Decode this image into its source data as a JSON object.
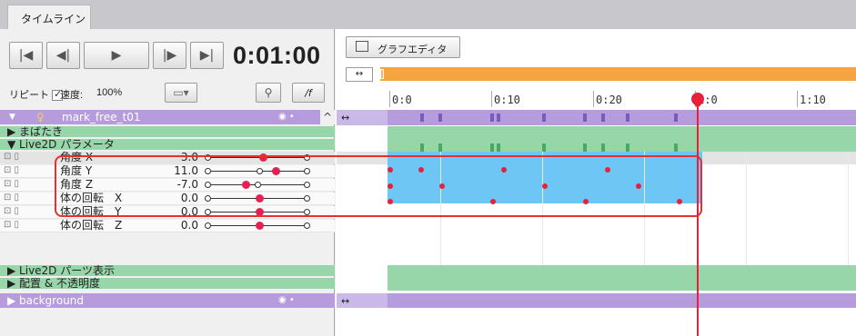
{
  "tab": {
    "label": "タイムライン"
  },
  "transport": {
    "timecode": "0:01:00",
    "buttons": [
      "jump-start",
      "prev-frame",
      "play",
      "next-frame",
      "jump-end"
    ]
  },
  "options": {
    "repeat_label": "リピート",
    "speed_label": "速度:",
    "speed_value": "100%",
    "f_button": "/f"
  },
  "rows": {
    "model_name": "mark_free_t01",
    "group_blink": "▶ まばたき",
    "group_params": "▼ Live2D パラメータ",
    "params": [
      {
        "name": "角度 X",
        "value": "3.0",
        "knob": 0.55,
        "ring": null
      },
      {
        "name": "角度 Y",
        "value": "11.0",
        "knob": 0.68,
        "ring": 0.52
      },
      {
        "name": "角度 Z",
        "value": "-7.0",
        "knob": 0.38,
        "ring": 0.5
      },
      {
        "name": "体の回転　X",
        "value": "0.0",
        "knob": 0.52,
        "ring": null
      },
      {
        "name": "体の回転　Y",
        "value": "0.0",
        "knob": 0.52,
        "ring": null
      },
      {
        "name": "体の回転　Z",
        "value": "0.0",
        "knob": 0.52,
        "ring": null
      }
    ],
    "group_parts": "▶ Live2D パーツ表示",
    "group_placement": "▶ 配置 & 不透明度",
    "background_name": "▶ background"
  },
  "graph_editor": {
    "label": "グラフエディタ"
  },
  "ruler": {
    "labels": [
      "0:0",
      "0:10",
      "0:20",
      "1:0",
      "1:10"
    ]
  },
  "playhead": {
    "time": "1:0"
  },
  "colors": {
    "purple": "#b69cdc",
    "green": "#96d6a8",
    "blue_selection": "#6ec6f5",
    "orange": "#f5a540",
    "red": "#e8203a"
  }
}
